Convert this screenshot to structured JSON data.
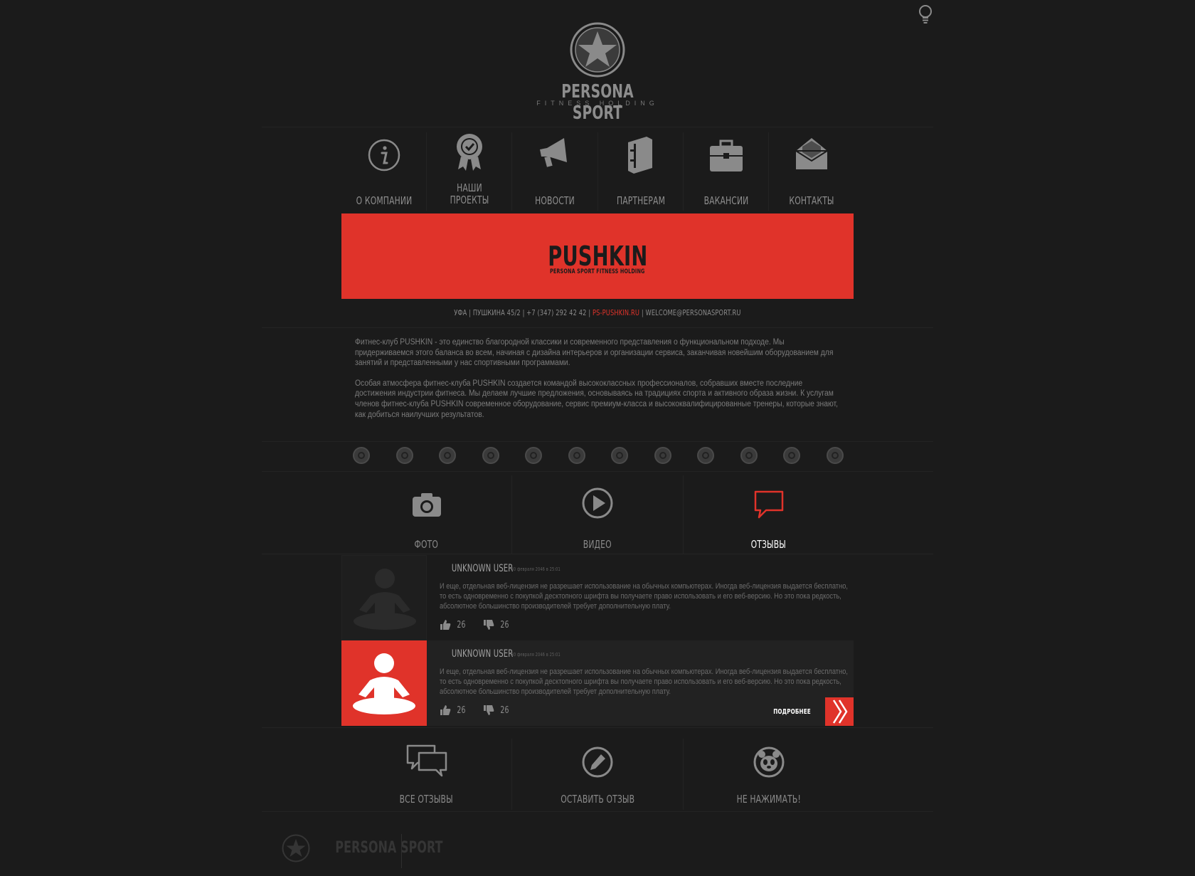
{
  "brand": {
    "name": "PERSONA SPORT",
    "tagline": "FITNESS HOLDING"
  },
  "nav": [
    {
      "label": "О КОМПАНИИ",
      "icon": "info-icon"
    },
    {
      "label": "НАШИ ПРОЕКТЫ",
      "line1": "НАШИ",
      "line2": "ПРОЕКТЫ",
      "icon": "award-icon"
    },
    {
      "label": "НОВОСТИ",
      "icon": "megaphone-icon"
    },
    {
      "label": "ПАРТНЕРАМ",
      "icon": "folder-icon"
    },
    {
      "label": "ВАКАНСИИ",
      "icon": "briefcase-icon"
    },
    {
      "label": "КОНТАКТЫ",
      "icon": "envelope-icon"
    }
  ],
  "banner": {
    "title": "PUSHKIN",
    "subtitle": "PERSONA SPORT FITNESS HOLDING"
  },
  "contact": {
    "address": "УФА | ПУШКИНА 45/2 | +7 (347) 292 42 42 | ",
    "site": "PS-PUSHKIN.RU",
    "email": " | WELCOME@PERSONASPORT.RU"
  },
  "about": {
    "p1": "Фитнес-клуб PUSHKIN - это единство благородной классики и современного представления о функциональном подходе. Мы придерживаемся этого баланса во всем, начиная с дизайна интерьеров и организации сервиса, заканчивая новейшим оборудованием для занятий и представленными у нас спортивными программами.",
    "p2": "Особая атмосфера фитнес-клуба PUSHKIN создается командой высококлассных профессионалов, собравших вместе последние достижения индустрии фитнеса. Мы делаем лучшие предложения, основываясь на традициях спорта и активного образа жизни. К услугам членов фитнес-клуба PUSHKIN современное оборудование, сервис премиум-класса и высококвалифицированные тренеры, которые знают, как добиться наилучших результатов."
  },
  "service_icons_count": 12,
  "tabs": [
    {
      "label": "ФОТО",
      "icon": "camera-icon"
    },
    {
      "label": "ВИДЕО",
      "icon": "play-icon"
    },
    {
      "label": "ОТЗЫВЫ",
      "icon": "speech-bubble-icon",
      "active": true
    }
  ],
  "reviews": [
    {
      "user": "UNKNOWN USER",
      "date": "30 февраля 2046 в 25:01",
      "text": "И еще, отдельная веб-лицензия не разрешает использование на обычных компьютерах. Иногда веб-лицензия выдается бесплатно, то есть одновременно с покупкой десктопного шрифта вы получаете право использовать и его веб-версию. Но это пока редкость, абсолютное большинство производителей требует дополнительную плату.",
      "likes": "26",
      "dislikes": "26"
    },
    {
      "user": "UNKNOWN USER",
      "date": "30 февраля 2046 в 25:01",
      "text": "И еще, отдельная веб-лицензия не разрешает использование на обычных компьютерах. Иногда веб-лицензия выдается бесплатно, то есть одновременно с покупкой десктопного шрифта вы получаете право использовать и его веб-версию. Но это пока редкость, абсолютное большинство производителей требует дополнительную плату.",
      "likes": "26",
      "dislikes": "26",
      "more_label": "ПОДРОБНЕЕ"
    }
  ],
  "actions": [
    {
      "label": "ВСЕ ОТЗЫВЫ",
      "icon": "chat-bubbles-icon"
    },
    {
      "label": "ОСТАВИТЬ ОТЗЫВ",
      "icon": "pencil-icon"
    },
    {
      "label": "НЕ НАЖИМАТЬ!",
      "icon": "panda-icon"
    }
  ],
  "colors": {
    "accent": "#e0332a",
    "background": "#1b1b1b",
    "text": "#8a8a8a"
  }
}
